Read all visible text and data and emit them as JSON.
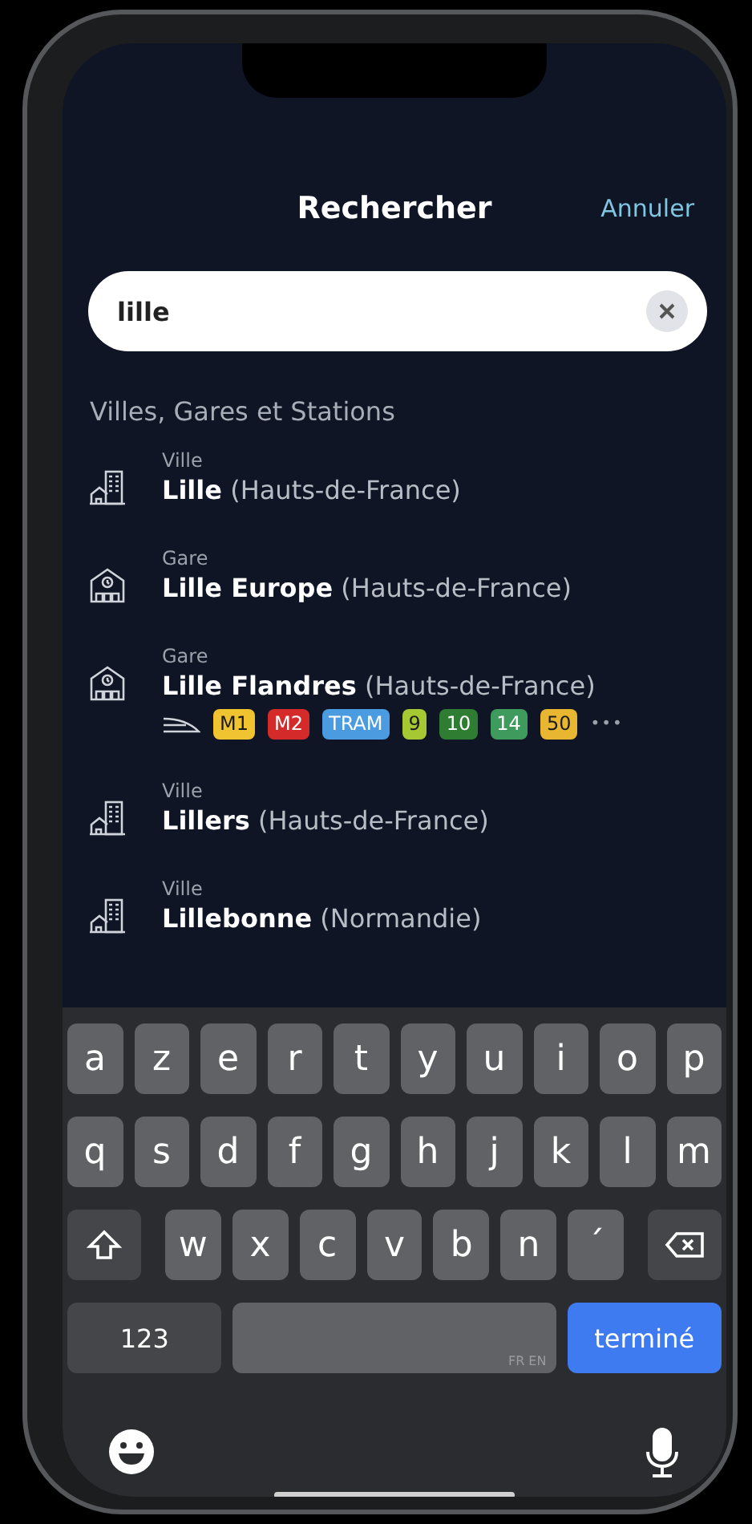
{
  "header": {
    "title": "Rechercher",
    "cancel": "Annuler"
  },
  "search": {
    "value": "lille"
  },
  "section_title": "Villes, Gares et Stations",
  "results": [
    {
      "kind": "ville",
      "type_label": "Ville",
      "name": "Lille",
      "region": "(Hauts-de-France)"
    },
    {
      "kind": "gare",
      "type_label": "Gare",
      "name": "Lille Europe",
      "region": "(Hauts-de-France)"
    },
    {
      "kind": "gare",
      "type_label": "Gare",
      "name": "Lille Flandres",
      "region": "(Hauts-de-France)",
      "lines": [
        {
          "label": "M1",
          "color": "#f0c330",
          "dark_text": true
        },
        {
          "label": "M2",
          "color": "#d42a2a",
          "dark_text": false
        },
        {
          "label": "TRAM",
          "color": "#4b9be0",
          "dark_text": false
        },
        {
          "label": "9",
          "color": "#a6c832",
          "dark_text": true
        },
        {
          "label": "10",
          "color": "#2e7d32",
          "dark_text": false
        },
        {
          "label": "14",
          "color": "#3f9a5e",
          "dark_text": false
        },
        {
          "label": "50",
          "color": "#e8b630",
          "dark_text": true
        }
      ],
      "more": "•••"
    },
    {
      "kind": "ville",
      "type_label": "Ville",
      "name": "Lillers",
      "region": "(Hauts-de-France)"
    },
    {
      "kind": "ville",
      "type_label": "Ville",
      "name": "Lillebonne",
      "region": "(Normandie)"
    }
  ],
  "keyboard": {
    "rows": [
      [
        "a",
        "z",
        "e",
        "r",
        "t",
        "y",
        "u",
        "i",
        "o",
        "p"
      ],
      [
        "q",
        "s",
        "d",
        "f",
        "g",
        "h",
        "j",
        "k",
        "l",
        "m"
      ],
      [
        "w",
        "x",
        "c",
        "v",
        "b",
        "n",
        "´"
      ]
    ],
    "numbers_key": "123",
    "space_label": "FR EN",
    "done_key": "terminé"
  }
}
